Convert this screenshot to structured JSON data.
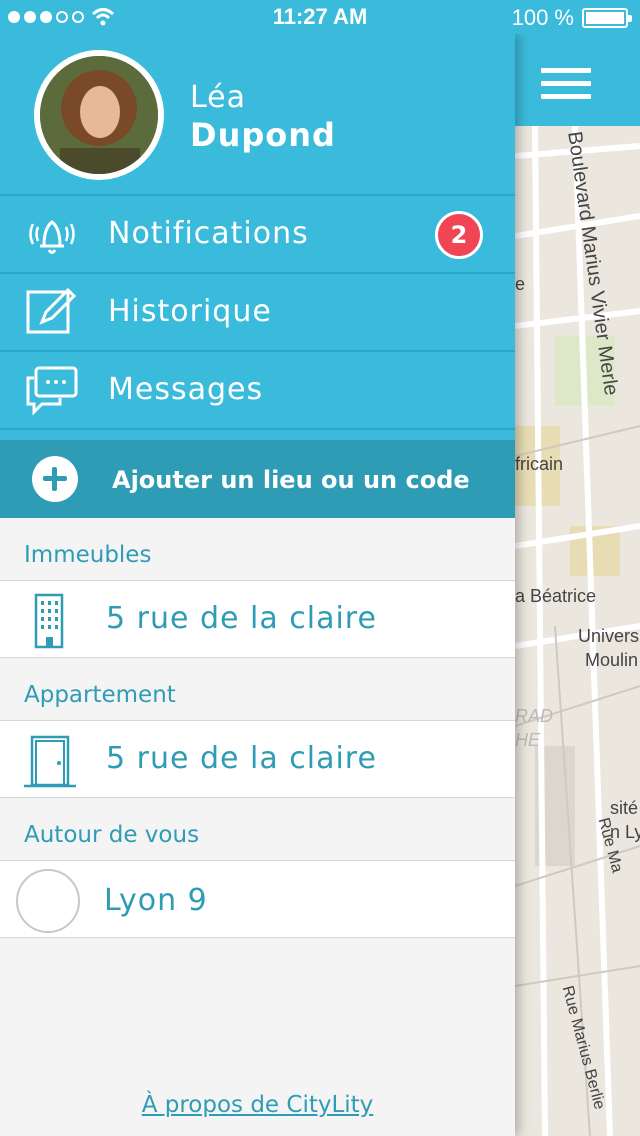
{
  "status_bar": {
    "time": "11:27 AM",
    "battery": "100 %",
    "signal_bars": 3,
    "signal_total": 5
  },
  "user": {
    "first_name": "Léa",
    "last_name": "Dupond"
  },
  "menu": [
    {
      "label": "Notifications",
      "icon": "bell-icon",
      "badge": "2"
    },
    {
      "label": "Historique",
      "icon": "edit-icon"
    },
    {
      "label": "Messages",
      "icon": "chat-icon"
    }
  ],
  "add_action": {
    "label": "Ajouter un lieu ou un code"
  },
  "sections": [
    {
      "title": "Immeubles",
      "item": "5 rue de la claire",
      "icon": "building-icon"
    },
    {
      "title": "Appartement",
      "item": "5 rue de la claire",
      "icon": "door-icon"
    },
    {
      "title": "Autour de vous",
      "item": "Lyon 9",
      "icon": "placeholder-circle-icon"
    }
  ],
  "footer": {
    "about_link": "À propos de CityLity"
  },
  "map": {
    "labels": [
      "Boulevard Marius Vivier Merle",
      "e",
      "fricain",
      "a Béatrice",
      "Univers",
      "Moulin",
      "RAD",
      "HE",
      "sité",
      "n Ly",
      "Rue Ma",
      "Rue Marius Berlie"
    ]
  },
  "colors": {
    "primary": "#3bbbdb",
    "primary_dark": "#2f9cb6",
    "badge": "#ef4555"
  }
}
